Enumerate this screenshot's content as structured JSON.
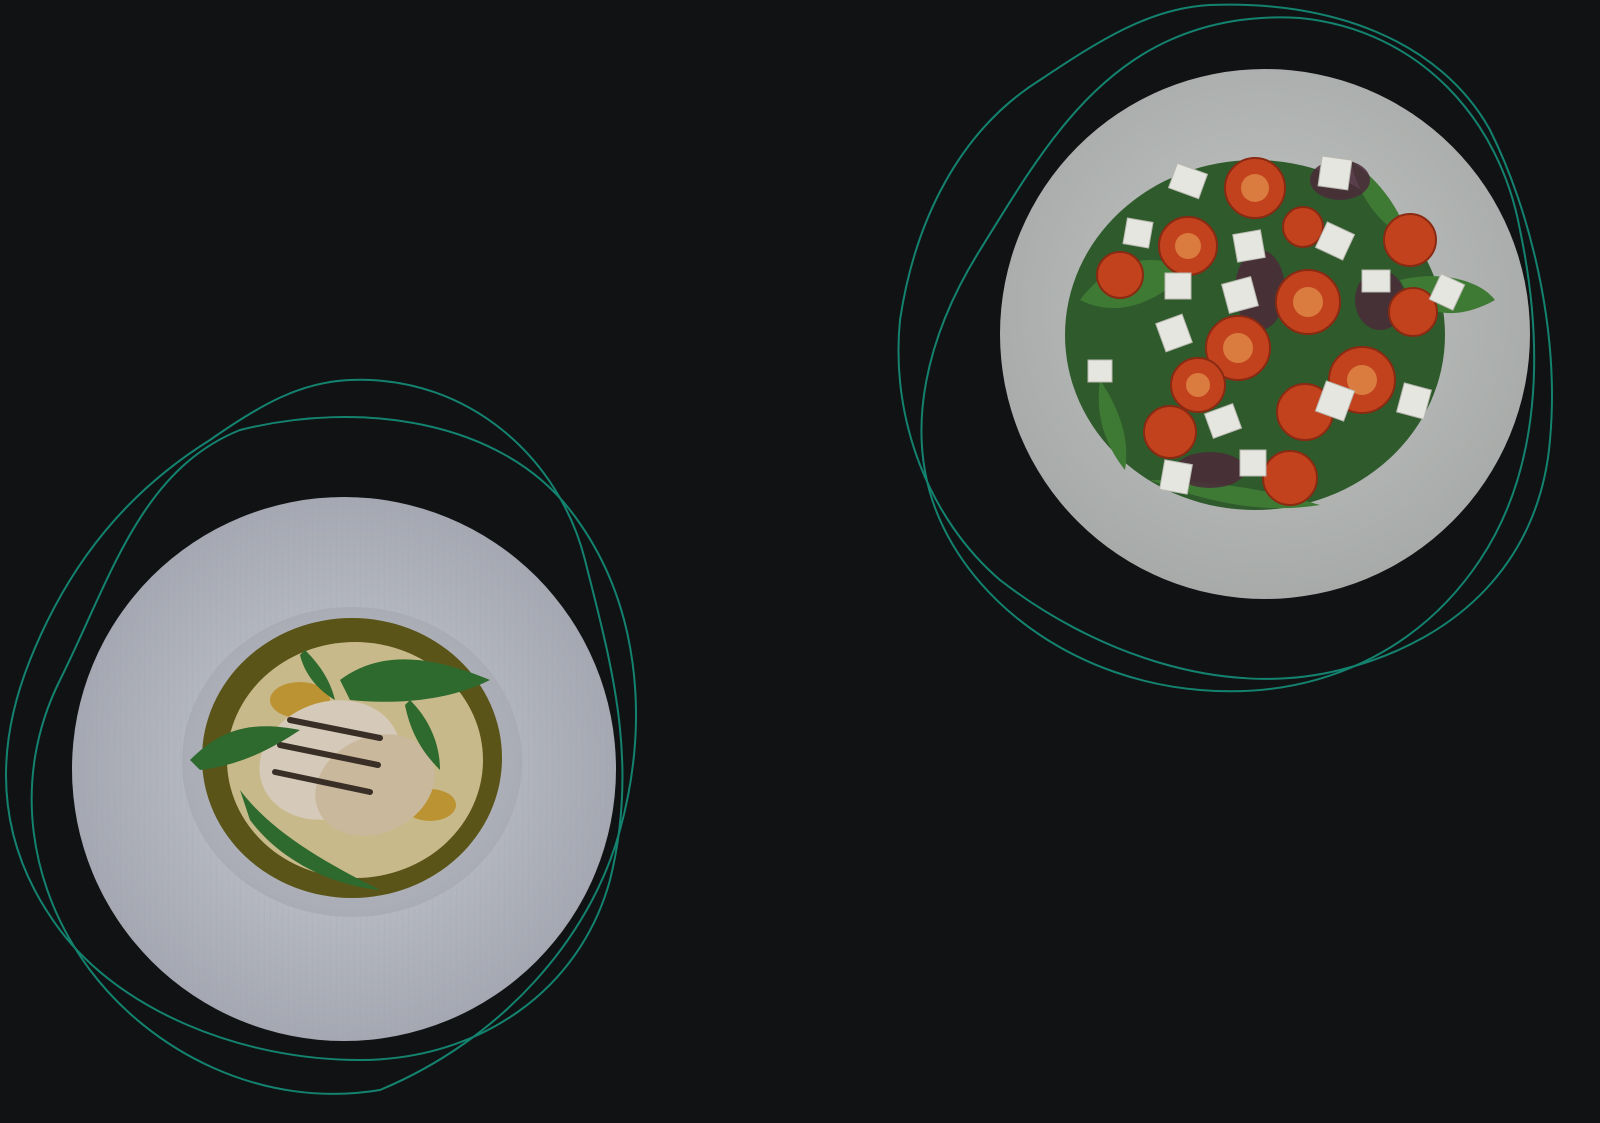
{
  "colors": {
    "background": "#111214",
    "accent_outline": "#13836f",
    "plate_risotto": "#b9bcc4",
    "plate_salad": "#bcbfbd"
  },
  "images": [
    {
      "name": "risotto-plate",
      "description_icon": "food-plate-icon"
    },
    {
      "name": "salad-plate",
      "description_icon": "food-plate-icon"
    }
  ]
}
